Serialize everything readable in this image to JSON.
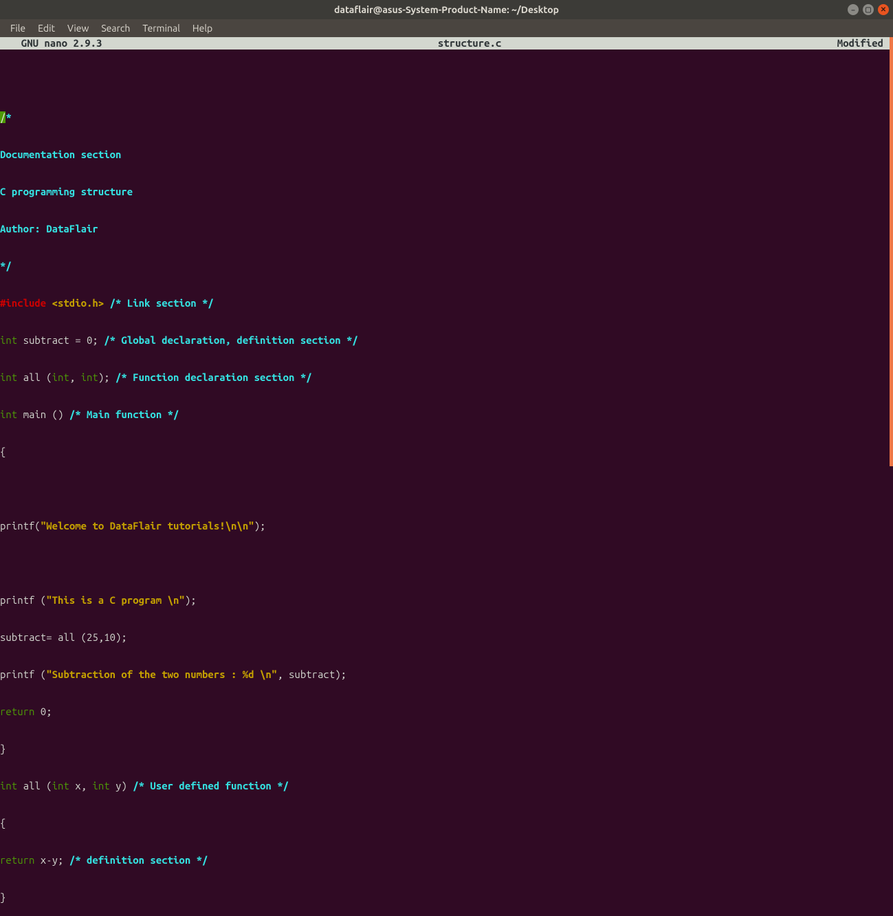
{
  "titlebar": {
    "title": "dataflair@asus-System-Product-Name: ~/Desktop",
    "buttons": {
      "min": "–",
      "max": "▢",
      "close": "✕"
    }
  },
  "menubar": {
    "items": [
      "File",
      "Edit",
      "View",
      "Search",
      "Terminal",
      "Help"
    ]
  },
  "statusbar": {
    "left": "  GNU nano 2.9.3",
    "center": "structure.c",
    "right": "Modified"
  },
  "code": {
    "l0a": "/",
    "l0b": "*",
    "l1": "Documentation section",
    "l2": "C programming structure",
    "l3": "Author: DataFlair",
    "l4": "*/",
    "l5a": "#include",
    "l5b": " <stdio.h>",
    "l5c": " /* Link section */",
    "l6a": "int",
    "l6b": " subtract = 0; ",
    "l6c": "/* Global declaration, definition section */",
    "l7a": "int",
    "l7b": " all (",
    "l7c": "int",
    "l7d": ", ",
    "l7e": "int",
    "l7f": "); ",
    "l7g": "/* Function declaration section */",
    "l8a": "int",
    "l8b": " main () ",
    "l8c": "/* Main function */",
    "l9": "{",
    "l11a": "printf(",
    "l11b": "\"Welcome to DataFlair tutorials!\\n\\n\"",
    "l11c": ");",
    "l13a": "printf (",
    "l13b": "\"This is a C program \\n\"",
    "l13c": ");",
    "l14": "subtract= all (25,10);",
    "l15a": "printf (",
    "l15b": "\"Subtraction of the two numbers : %d \\n\"",
    "l15c": ", subtract);",
    "l16a": "return",
    "l16b": " 0;",
    "l17": "}",
    "l18a": "int",
    "l18b": " all (",
    "l18c": "int",
    "l18d": " x, ",
    "l18e": "int",
    "l18f": " y) ",
    "l18g": "/* User defined function */",
    "l19": "{",
    "l20a": "return",
    "l20b": " x-y; ",
    "l20c": "/* definition section */",
    "l21": "}"
  }
}
